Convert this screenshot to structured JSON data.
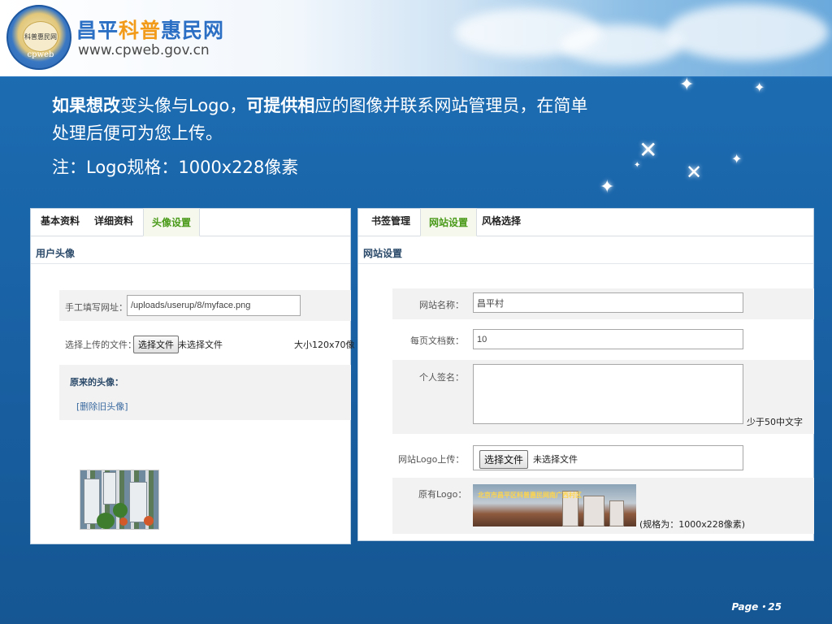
{
  "header": {
    "site_name_part1": "昌平",
    "site_name_part2": "科普",
    "site_name_part3": "惠民网",
    "site_url": "www.cpweb.gov.cn",
    "logo_text": "科普惠民网",
    "logo_word": "cpweb"
  },
  "description": {
    "line1_bold1": "如果想改",
    "line1_normal1": "变头像与Logo，",
    "line1_bold2": "可提供相",
    "line1_normal2": "应的图像并联系网站管理员，在简单",
    "line2": "处理后便可为您上传。",
    "line3": "注：Logo规格：1000x228像素"
  },
  "left_panel": {
    "tabs": [
      "基本资料",
      "详细资料",
      "头像设置"
    ],
    "active_tab": "头像设置",
    "subhead": "用户头像",
    "url_label": "手工填写网址：",
    "url_value": "/uploads/userup/8/myface.png",
    "upload_label": "选择上传的文件：",
    "choose_file_button": "选择文件",
    "no_file_text": "未选择文件",
    "size_hint": "大小120x70像",
    "original_avatar_label": "原来的头像：",
    "delete_link": "[删除旧头像]"
  },
  "right_panel": {
    "tabs": [
      "书签管理",
      "网站设置",
      "风格选择"
    ],
    "active_tab": "网站设置",
    "subhead": "网站设置",
    "site_name_label": "网站名称：",
    "site_name_value": "昌平村",
    "per_page_label": "每页文档数：",
    "per_page_value": "10",
    "signature_label": "个人签名：",
    "signature_hint": "少于50中文字",
    "logo_upload_label": "网站Logo上传：",
    "choose_file_button": "选择文件",
    "no_file_text": "未选择文件",
    "original_logo_label": "原有Logo：",
    "logo_spec": "(规格为：1000x228像素)",
    "logo_banner_text": "北京市昌平区科普惠民网南广西村区"
  },
  "footer": {
    "page_label": "Page・25"
  }
}
